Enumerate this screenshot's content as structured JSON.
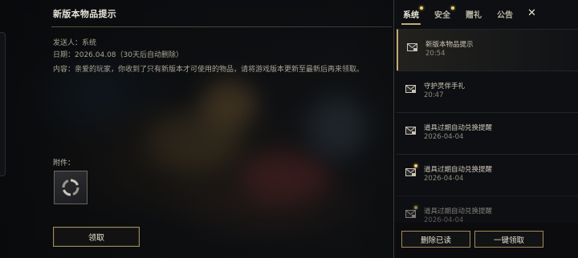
{
  "detail": {
    "title": "新版本物品提示",
    "sender": "发送人：系统",
    "date": "日期：2026.04.08（30天后自动删除）",
    "content": "内容：亲爱的玩家，你收到了只有新版本才可使用的物品，请将游戏版本更新至最新后再来领取。",
    "attachment_label": "附件：",
    "attachment_icon": "refresh-item-icon",
    "claim_button": "领取"
  },
  "panel": {
    "tabs": [
      {
        "label": "系统",
        "active": true,
        "has_dot": true
      },
      {
        "label": "安全",
        "active": false,
        "has_dot": true
      },
      {
        "label": "赠礼",
        "active": false,
        "has_dot": false
      },
      {
        "label": "公告",
        "active": false,
        "has_dot": false
      }
    ],
    "close_icon": "close-icon",
    "mails": [
      {
        "title": "新版本物品提示",
        "time": "20:54",
        "selected": true,
        "unread": false
      },
      {
        "title": "守护灵伴手礼",
        "time": "20:47",
        "selected": false,
        "unread": false
      },
      {
        "title": "道具过期自动兑换提醒",
        "time": "2026-04-04",
        "selected": false,
        "unread": false
      },
      {
        "title": "道具过期自动兑换提醒",
        "time": "2026-04-04",
        "selected": false,
        "unread": true
      },
      {
        "title": "道具过期自动兑换提醒",
        "time": "2026-04-04",
        "selected": false,
        "unread": true
      }
    ],
    "delete_read_button": "删除已读",
    "claim_all_button": "一键领取"
  },
  "colors": {
    "accent_gold": "#c8aa6e",
    "new_dot": "#f2cf6a"
  }
}
